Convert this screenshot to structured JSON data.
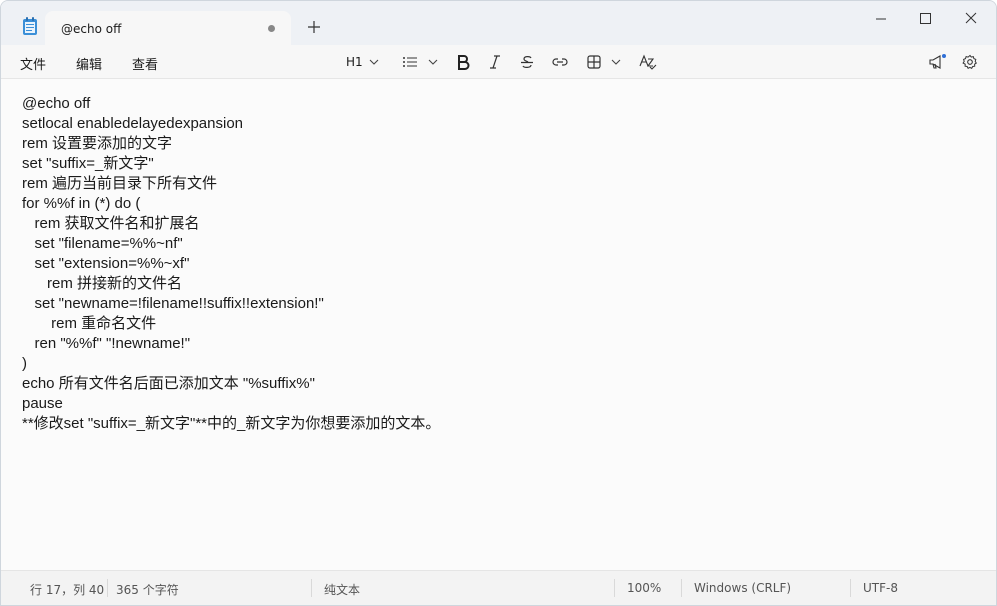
{
  "window": {
    "tab_title": "@echo off"
  },
  "menu": {
    "file": "文件",
    "edit": "编辑",
    "view": "查看"
  },
  "toolbar": {
    "heading_label": "H1",
    "icons": [
      "list-icon",
      "bold-icon",
      "italic-icon",
      "strikethrough-icon",
      "link-icon",
      "table-icon",
      "spellcheck-icon",
      "announcement-icon",
      "settings-icon"
    ]
  },
  "editor": {
    "lines": [
      "@echo off",
      "setlocal enabledelayedexpansion",
      "rem 设置要添加的文字",
      "set \"suffix=_新文字\"",
      "rem 遍历当前目录下所有文件",
      "for %%f in (*) do (",
      "   rem 获取文件名和扩展名",
      "   set \"filename=%%~nf\"",
      "   set \"extension=%%~xf\"",
      "      rem 拼接新的文件名",
      "   set \"newname=!filename!!suffix!!extension!\"",
      "       rem 重命名文件",
      "   ren \"%%f\" \"!newname!\"",
      ")",
      "echo 所有文件名后面已添加文本 \"%suffix%\"",
      "pause",
      "**修改set \"suffix=_新文字\"**中的_新文字为你想要添加的文本。"
    ]
  },
  "status": {
    "position": "行 17，列 40",
    "chars": "365 个字符",
    "format": "纯文本",
    "zoom": "100%",
    "line_ending": "Windows (CRLF)",
    "encoding": "UTF-8"
  },
  "colors": {
    "accent": "#2f6fd6",
    "titlebar": "#eef1f5",
    "editor_bg": "#fbfbfb"
  }
}
